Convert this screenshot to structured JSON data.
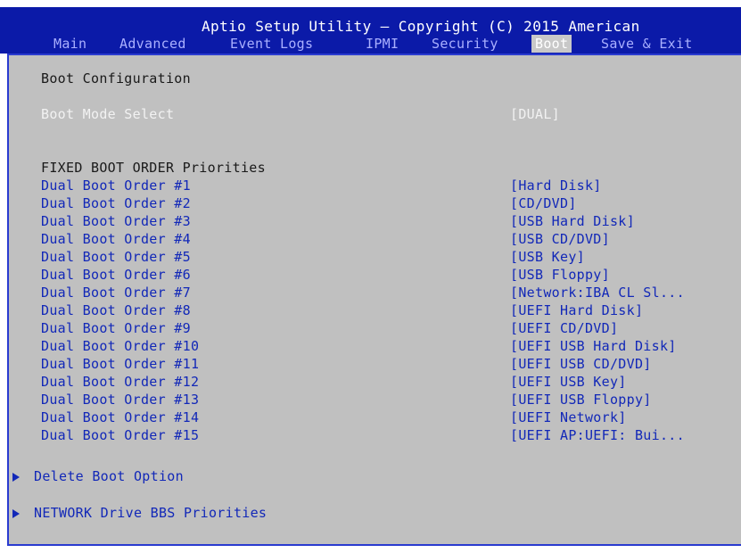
{
  "header": {
    "title": "Aptio Setup Utility – Copyright (C) 2015 American",
    "tabs": [
      {
        "label": "Main",
        "active": false
      },
      {
        "label": "Advanced",
        "active": false
      },
      {
        "label": "Event Logs",
        "active": false
      },
      {
        "label": "IPMI",
        "active": false
      },
      {
        "label": "Security",
        "active": false
      },
      {
        "label": "Boot",
        "active": true
      },
      {
        "label": "Save & Exit",
        "active": false
      }
    ]
  },
  "boot": {
    "section_title": "Boot Configuration",
    "mode": {
      "label": "Boot Mode Select",
      "value": "[DUAL]"
    },
    "fixed_title": "FIXED BOOT ORDER Priorities",
    "orders": [
      {
        "label": "Dual Boot Order #1",
        "value": "[Hard Disk]"
      },
      {
        "label": "Dual Boot Order #2",
        "value": "[CD/DVD]"
      },
      {
        "label": "Dual Boot Order #3",
        "value": "[USB Hard Disk]"
      },
      {
        "label": "Dual Boot Order #4",
        "value": "[USB CD/DVD]"
      },
      {
        "label": "Dual Boot Order #5",
        "value": "[USB Key]"
      },
      {
        "label": "Dual Boot Order #6",
        "value": "[USB Floppy]"
      },
      {
        "label": "Dual Boot Order #7",
        "value": "[Network:IBA CL Sl..."
      },
      {
        "label": "Dual Boot Order #8",
        "value": "[UEFI Hard Disk]"
      },
      {
        "label": "Dual Boot Order #9",
        "value": "[UEFI CD/DVD]"
      },
      {
        "label": "Dual Boot Order #10",
        "value": "[UEFI USB Hard Disk]"
      },
      {
        "label": "Dual Boot Order #11",
        "value": "[UEFI USB CD/DVD]"
      },
      {
        "label": "Dual Boot Order #12",
        "value": "[UEFI USB Key]"
      },
      {
        "label": "Dual Boot Order #13",
        "value": "[UEFI USB Floppy]"
      },
      {
        "label": "Dual Boot Order #14",
        "value": "[UEFI Network]"
      },
      {
        "label": "Dual Boot Order #15",
        "value": "[UEFI AP:UEFI: Bui..."
      }
    ],
    "submenus": [
      {
        "label": "Delete Boot Option"
      },
      {
        "label": "NETWORK Drive BBS Priorities"
      }
    ]
  },
  "colors": {
    "header_bg": "#0b1aa8",
    "panel_bg": "#c0c0c0",
    "item_blue": "#1228b8",
    "selected_text": "#f2f2f2"
  }
}
